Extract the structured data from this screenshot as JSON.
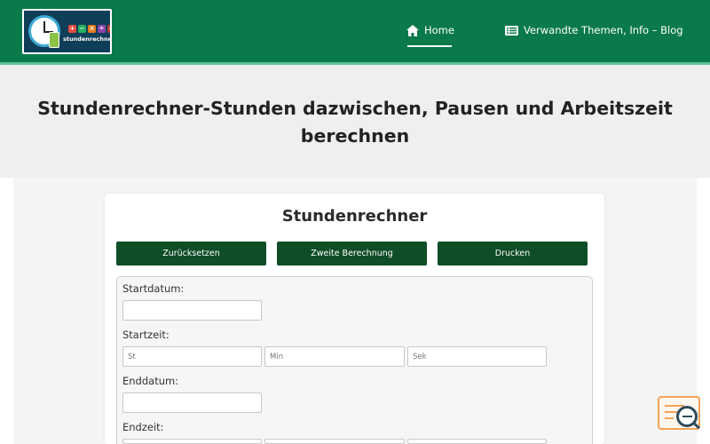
{
  "header": {
    "logo_text": "stundenrechner.de",
    "nav": {
      "home": "Home",
      "blog": "Verwandte Themen, Info – Blog"
    }
  },
  "hero": {
    "title": "Stundenrechner-Stunden dazwischen, Pausen und Arbeitszeit berechnen"
  },
  "calculator": {
    "title": "Stundenrechner",
    "buttons": {
      "reset": "Zurücksetzen",
      "second": "Zweite Berechnung",
      "print": "Drucken"
    },
    "fields": {
      "start_date_label": "Startdatum:",
      "start_time_label": "Startzeit:",
      "end_date_label": "Enddatum:",
      "end_time_label": "Endzeit:",
      "hour_placeholder": "St",
      "min_placeholder": "Min",
      "sec_placeholder": "Sek"
    }
  },
  "colors": {
    "header_bg": "#0b7a4b",
    "button_bg": "#0e4d25",
    "accent_line": "#5fc296"
  },
  "icons": {
    "home": "home-icon",
    "blog": "list-icon",
    "floating": "search-document-icon"
  }
}
